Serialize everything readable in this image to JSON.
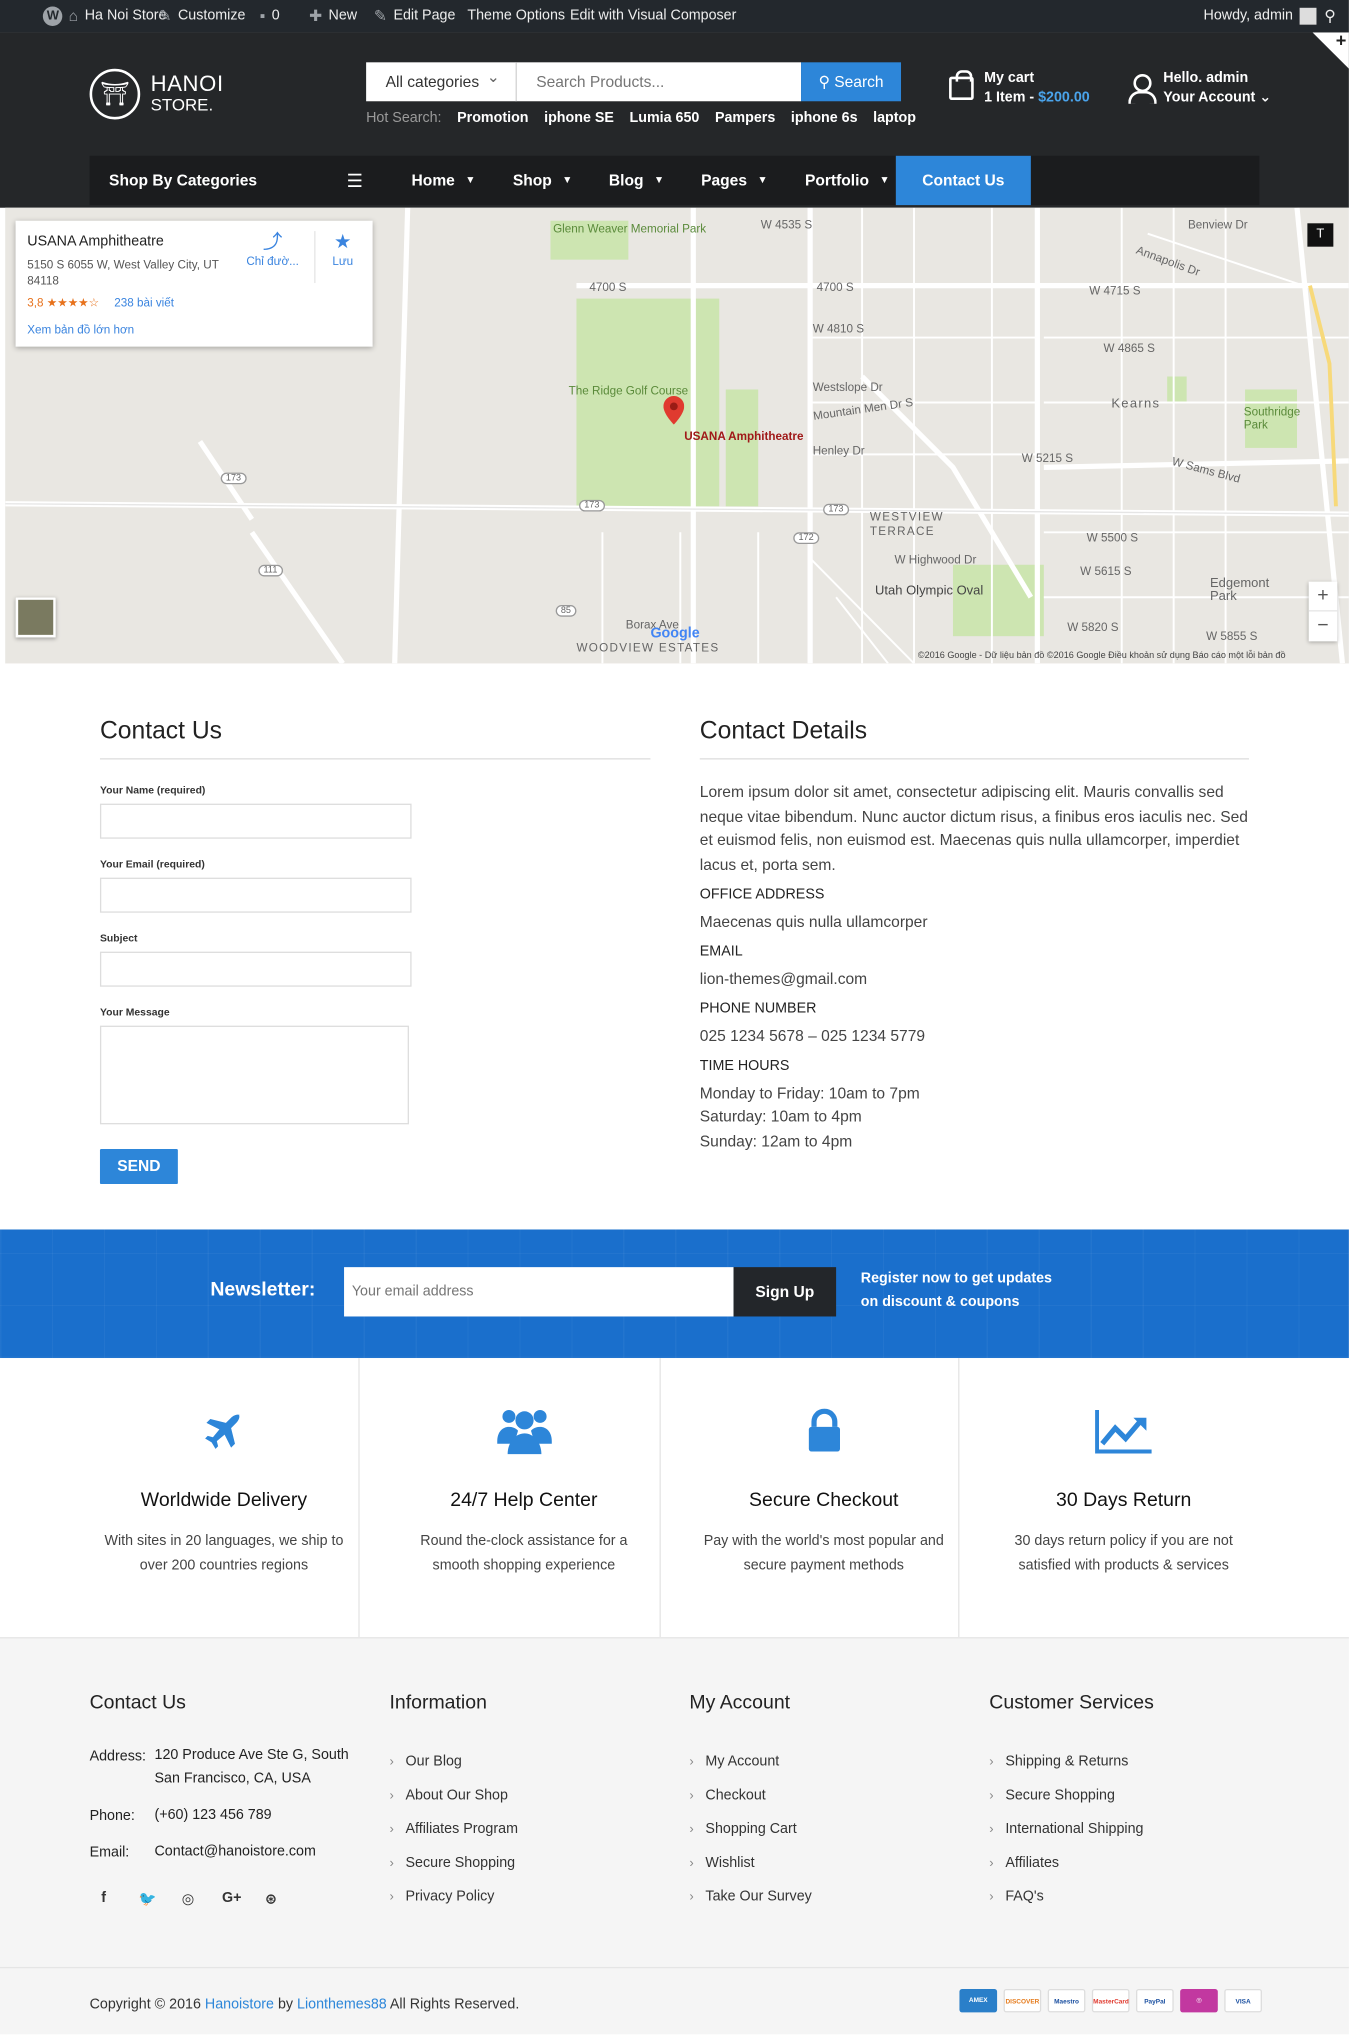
{
  "admin_bar": {
    "site": "Ha Noi Store",
    "customize": "Customize",
    "comments": "0",
    "new": "New",
    "edit_page": "Edit Page",
    "theme_options": "Theme Options",
    "visual_composer": "Edit with Visual Composer",
    "howdy": "Howdy, admin"
  },
  "header": {
    "logo_line1": "HANOI",
    "logo_line2": "STORE.",
    "category_select": "All categories",
    "search_placeholder": "Search Products...",
    "search_button": "Search",
    "hot_label": "Hot Search:",
    "hot_keywords": [
      "Promotion",
      "iphone SE",
      "Lumia 650",
      "Pampers",
      "iphone 6s",
      "laptop"
    ],
    "cart_title": "My cart",
    "cart_items": "1 Item - ",
    "cart_total": "$200.00",
    "account_hello": "Hello. admin",
    "account_label": "Your Account"
  },
  "nav": {
    "categories": "Shop By Categories",
    "items": [
      "Home",
      "Shop",
      "Blog",
      "Pages",
      "Portfolio",
      "Contact Us"
    ]
  },
  "map": {
    "place": "USANA Amphitheatre",
    "address": "5150 S 6055 W, West Valley City, UT 84118",
    "rating": "3,8 ★★★★☆",
    "reviews": "238 bài viết",
    "larger_map": "Xem bản đồ lớn hơn",
    "directions": "Chỉ đườ...",
    "save": "Lưu",
    "labels": [
      "Glenn Weaver Memorial Park",
      "The Ridge Golf Course",
      "USANA Amphitheatre",
      "WESTVIEW TERRACE",
      "Utah Olympic Oval",
      "Kearns",
      "Edgemont Park",
      "Southridge Park",
      "W 4535 S",
      "4700 S",
      "W 4810 S",
      "W 4865 S",
      "W 5215 S",
      "W 5500 S",
      "W Highwood Dr",
      "W 5615 S",
      "W 5820 S",
      "W 5855 S",
      "Benview Dr",
      "Annapolis Dr",
      "W 4715 S",
      "W Sams Blvd",
      "Westslope Dr",
      "Mountain Men Dr S",
      "Henley Dr",
      "Borax Ave",
      "WOODVIEW ESTATES",
      "173",
      "172",
      "111",
      "85"
    ],
    "copyright": "©2016 Google - Dữ liệu bản đồ ©2016 Google   Điều khoản sử dụng   Báo cáo một lỗi bản đồ",
    "google": "Google"
  },
  "contact_form": {
    "title": "Contact Us",
    "name_label": "Your Name (required)",
    "email_label": "Your Email (required)",
    "subject_label": "Subject",
    "message_label": "Your Message",
    "send": "SEND"
  },
  "contact_details": {
    "title": "Contact Details",
    "intro": "Lorem ipsum dolor sit amet, consectetur adipiscing elit. Mauris convallis sed neque vitae bibendum. Nunc auctor dictum risus, a finibus eros iaculis nec. Sed et euismod felis, non euismod est. Maecenas quis nulla ullamcorper, imperdiet lacus et, porta sem.",
    "office_label": "OFFICE ADDRESS",
    "office": "Maecenas quis nulla ullamcorper",
    "email_label": "EMAIL",
    "email": "lion-themes@gmail.com",
    "phone_label": "PHONE NUMBER",
    "phone": "025 1234 5678 – 025 1234 5779",
    "hours_label": "TIME HOURS",
    "hours": [
      "Monday to Friday: 10am to 7pm",
      "Saturday: 10am to 4pm",
      "Sunday: 12am to 4pm"
    ]
  },
  "newsletter": {
    "label": "Newsletter:",
    "placeholder": "Your email address",
    "button": "Sign Up",
    "register_line1": "Register now to get updates",
    "register_line2": "on discount & coupons"
  },
  "features": [
    {
      "icon": "plane-icon",
      "title": "Worldwide Delivery",
      "desc": "With sites in 20 languages, we ship to over 200 countries regions"
    },
    {
      "icon": "users-icon",
      "title": "24/7 Help Center",
      "desc": "Round the-clock assistance for a smooth shopping experience"
    },
    {
      "icon": "lock-icon",
      "title": "Secure Checkout",
      "desc": "Pay with the world's most popular and secure payment methods"
    },
    {
      "icon": "chart-icon",
      "title": "30 Days Return",
      "desc": "30 days return policy if you are not satisfied with products & services"
    }
  ],
  "footer": {
    "contact_title": "Contact Us",
    "address_label": "Address:",
    "address": "120 Produce Ave Ste G, South San Francisco, CA, USA",
    "phone_label": "Phone:",
    "phone": "(+60) 123 456 789",
    "email_label": "Email:",
    "email": "Contact@hanoistore.com",
    "social": [
      "f",
      "🐦",
      "◎",
      "G+",
      "⊛"
    ],
    "info_title": "Information",
    "info_links": [
      "Our Blog",
      "About Our Shop",
      "Affiliates Program",
      "Secure Shopping",
      "Privacy Policy"
    ],
    "account_title": "My Account",
    "account_links": [
      "My Account",
      "Checkout",
      "Shopping Cart",
      "Wishlist",
      "Take Our Survey"
    ],
    "services_title": "Customer Services",
    "services_links": [
      "Shipping & Returns",
      "Secure Shopping",
      "International Shipping",
      "Affiliates",
      "FAQ's"
    ],
    "copyright_prefix": "Copyright © 2016 ",
    "copyright_brand": "Hanoistore",
    "copyright_by": " by ",
    "copyright_author": "Lionthemes88",
    "copyright_suffix": " All Rights Reserved.",
    "payments": [
      "AMEX",
      "DISCOVER",
      "Maestro",
      "MasterCard",
      "PayPal",
      "◎",
      "VISA"
    ]
  },
  "colors": {
    "accent": "#2d86d9",
    "header_bg": "#252729",
    "nav_bg": "#1b1c1e",
    "newsletter_bg": "#1a6fcc"
  }
}
